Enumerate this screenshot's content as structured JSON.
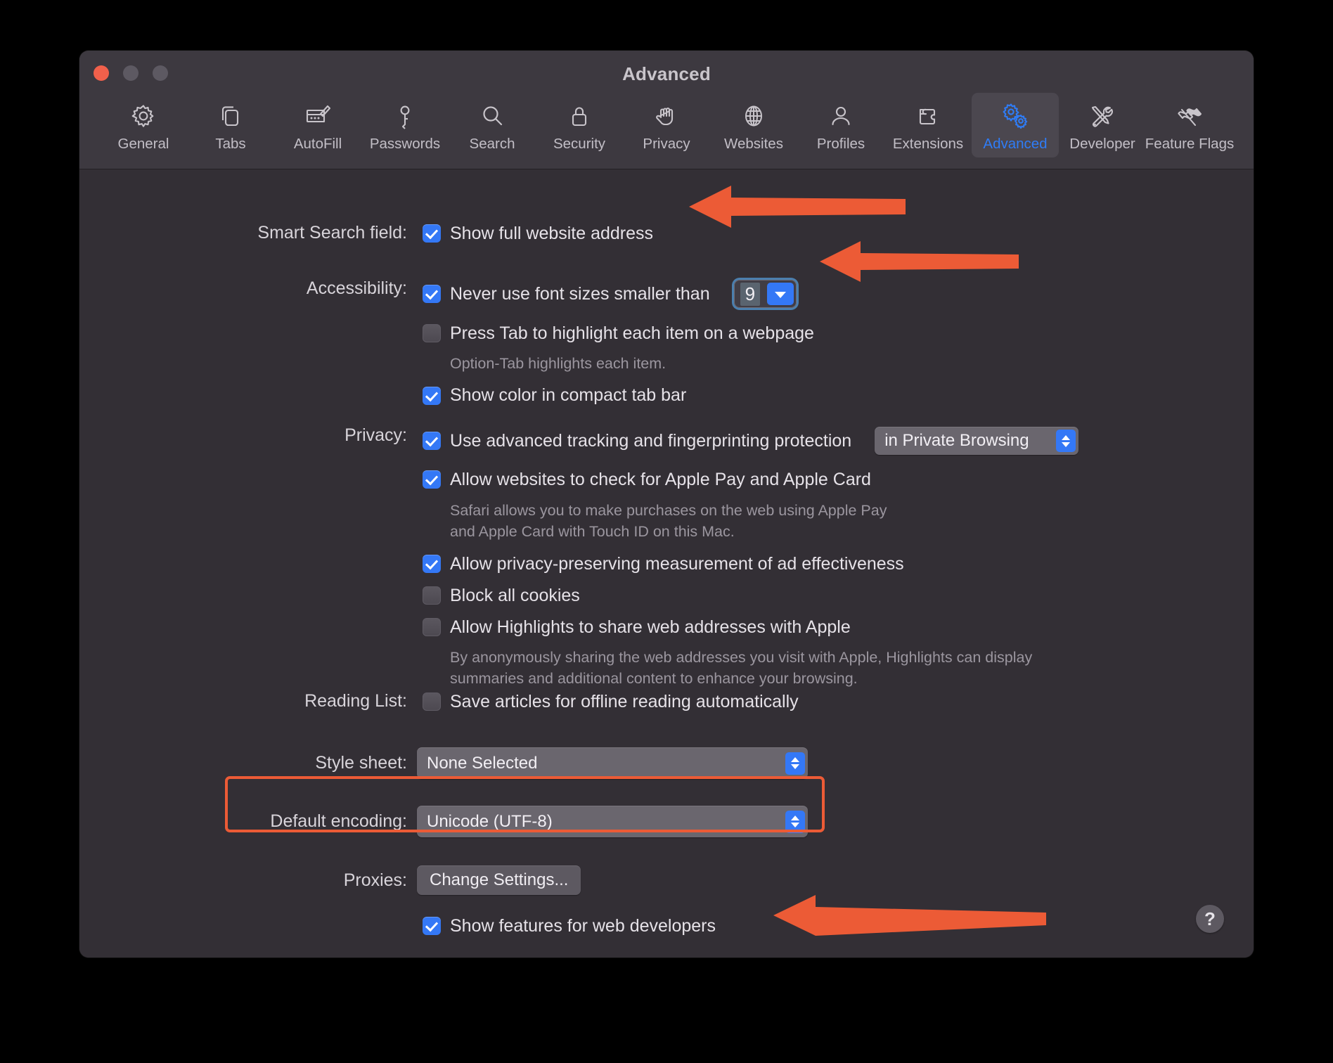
{
  "window": {
    "title": "Advanced",
    "traffic_lights": [
      "close",
      "minimize",
      "maximize"
    ]
  },
  "toolbar": {
    "items": [
      {
        "label": "General",
        "icon": "gear-icon",
        "selected": false
      },
      {
        "label": "Tabs",
        "icon": "tabs-icon",
        "selected": false
      },
      {
        "label": "AutoFill",
        "icon": "autofill-icon",
        "selected": false
      },
      {
        "label": "Passwords",
        "icon": "key-icon",
        "selected": false
      },
      {
        "label": "Search",
        "icon": "search-icon",
        "selected": false
      },
      {
        "label": "Security",
        "icon": "lock-icon",
        "selected": false
      },
      {
        "label": "Privacy",
        "icon": "hand-icon",
        "selected": false
      },
      {
        "label": "Websites",
        "icon": "globe-icon",
        "selected": false
      },
      {
        "label": "Profiles",
        "icon": "person-icon",
        "selected": false
      },
      {
        "label": "Extensions",
        "icon": "puzzle-icon",
        "selected": false
      },
      {
        "label": "Advanced",
        "icon": "gears-icon",
        "selected": true
      },
      {
        "label": "Developer",
        "icon": "tools-icon",
        "selected": false
      },
      {
        "label": "Feature Flags",
        "icon": "flags-icon",
        "selected": false
      }
    ],
    "selected_accent": "#2f7cf6"
  },
  "settings": {
    "smart_search": {
      "label": "Smart Search field:",
      "show_full_address": {
        "text": "Show full website address",
        "checked": true
      }
    },
    "accessibility": {
      "label": "Accessibility:",
      "min_font": {
        "text": "Never use font sizes smaller than",
        "checked": true,
        "value": "9"
      },
      "press_tab": {
        "text": "Press Tab to highlight each item on a webpage",
        "checked": false,
        "hint": "Option-Tab highlights each item."
      },
      "compact_tab_color": {
        "text": "Show color in compact tab bar",
        "checked": true
      }
    },
    "privacy": {
      "label": "Privacy:",
      "tracking": {
        "text": "Use advanced tracking and fingerprinting protection",
        "checked": true,
        "scope_value": "in Private Browsing"
      },
      "apple_pay": {
        "text": "Allow websites to check for Apple Pay and Apple Card",
        "checked": true,
        "hint": "Safari allows you to make purchases on the web using Apple Pay\nand Apple Card with Touch ID on this Mac."
      },
      "ad_measurement": {
        "text": "Allow privacy-preserving measurement of ad effectiveness",
        "checked": true
      },
      "block_cookies": {
        "text": "Block all cookies",
        "checked": false
      },
      "highlights": {
        "text": "Allow Highlights to share web addresses with Apple",
        "checked": false,
        "hint": "By anonymously sharing the web addresses you visit with Apple, Highlights can display\nsummaries and additional content to enhance your browsing."
      }
    },
    "reading_list": {
      "label": "Reading List:",
      "save_offline": {
        "text": "Save articles for offline reading automatically",
        "checked": false
      }
    },
    "style_sheet": {
      "label": "Style sheet:",
      "value": "None Selected"
    },
    "default_encoding": {
      "label": "Default encoding:",
      "value": "Unicode (UTF-8)"
    },
    "proxies": {
      "label": "Proxies:",
      "button": "Change Settings..."
    },
    "web_developers": {
      "text": "Show features for web developers",
      "checked": true
    },
    "help": {
      "glyph": "?"
    }
  },
  "annotations": {
    "highlight_color": "#ec5b36",
    "arrows": [
      {
        "target": "show-full-website-address"
      },
      {
        "target": "minimum-font-size-combo"
      },
      {
        "target": "show-features-for-web-developers"
      }
    ],
    "boxes": [
      {
        "target": "default-encoding-row"
      }
    ]
  }
}
